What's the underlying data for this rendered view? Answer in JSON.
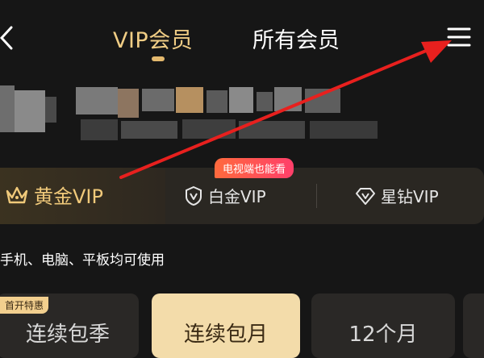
{
  "header": {
    "tabs": [
      {
        "label": "VIP会员",
        "active": true
      },
      {
        "label": "所有会员",
        "active": false
      }
    ],
    "back_icon": "chevron-left-icon",
    "menu_icon": "hamburger-menu-icon"
  },
  "membership_tiers": {
    "items": [
      {
        "label": "黄金VIP",
        "icon": "crown-icon",
        "active": true
      },
      {
        "label": "白金VIP",
        "icon": "shield-v-icon",
        "active": false
      },
      {
        "label": "星钻VIP",
        "icon": "diamond-v-icon",
        "active": false
      }
    ],
    "tv_badge": "电视端也能看"
  },
  "subtitle": "手机、电脑、平板均可使用",
  "plans": {
    "first_badge": "首开特惠",
    "items": [
      {
        "label": "连续包季",
        "selected": false
      },
      {
        "label": "连续包月",
        "selected": true
      },
      {
        "label": "12个月",
        "selected": false
      }
    ]
  },
  "colors": {
    "background": "#161616",
    "gold_accent": "#f0c97a",
    "selected_card": "#f3dcaa",
    "badge_gradient": [
      "#ff6a3d",
      "#ff3f6a"
    ],
    "arrow": "#e8201e"
  }
}
